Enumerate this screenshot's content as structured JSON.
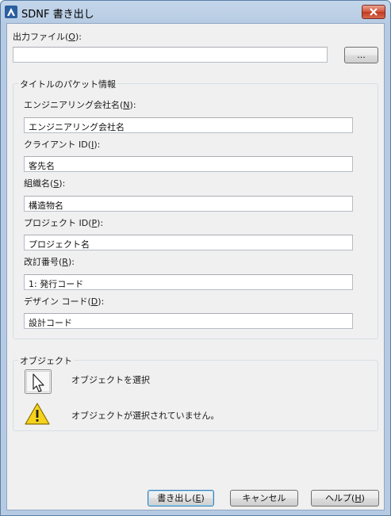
{
  "window": {
    "title": "SDNF 書き出し"
  },
  "output_file": {
    "label_pre": "出力ファイル(",
    "label_key": "O",
    "label_post": "):",
    "value": "",
    "browse_label": "..."
  },
  "packet_group": {
    "title": "タイトルのパケット情報",
    "fields": [
      {
        "label_pre": "エンジニアリング会社名(",
        "label_key": "N",
        "label_post": "):",
        "value": "エンジニアリング会社名"
      },
      {
        "label_pre": "クライアント ID(",
        "label_key": "I",
        "label_post": "):",
        "value": "客先名"
      },
      {
        "label_pre": "組織名(",
        "label_key": "S",
        "label_post": "):",
        "value": "構造物名"
      },
      {
        "label_pre": "プロジェクト ID(",
        "label_key": "P",
        "label_post": "):",
        "value": "プロジェクト名"
      },
      {
        "label_pre": "改訂番号(",
        "label_key": "R",
        "label_post": "):",
        "value": "1: 発行コード"
      },
      {
        "label_pre": "デザイン コード(",
        "label_key": "D",
        "label_post": "):",
        "value": "設計コード"
      }
    ]
  },
  "object_group": {
    "title": "オブジェクト",
    "select_label": "オブジェクトを選択",
    "warning_text": "オブジェクトが選択されていません。"
  },
  "buttons": {
    "export": {
      "pre": "書き出し(",
      "key": "E",
      "post": ")"
    },
    "cancel": "キャンセル",
    "help": {
      "pre": "ヘルプ(",
      "key": "H",
      "post": ")"
    }
  },
  "colors": {
    "title_gradient": "#c4d6ea",
    "close_button": "#c0391f",
    "warning_yellow": "#f5d31a"
  },
  "icons": [
    "autocad-app-icon",
    "close-icon",
    "select-objects-icon",
    "warning-icon"
  ]
}
